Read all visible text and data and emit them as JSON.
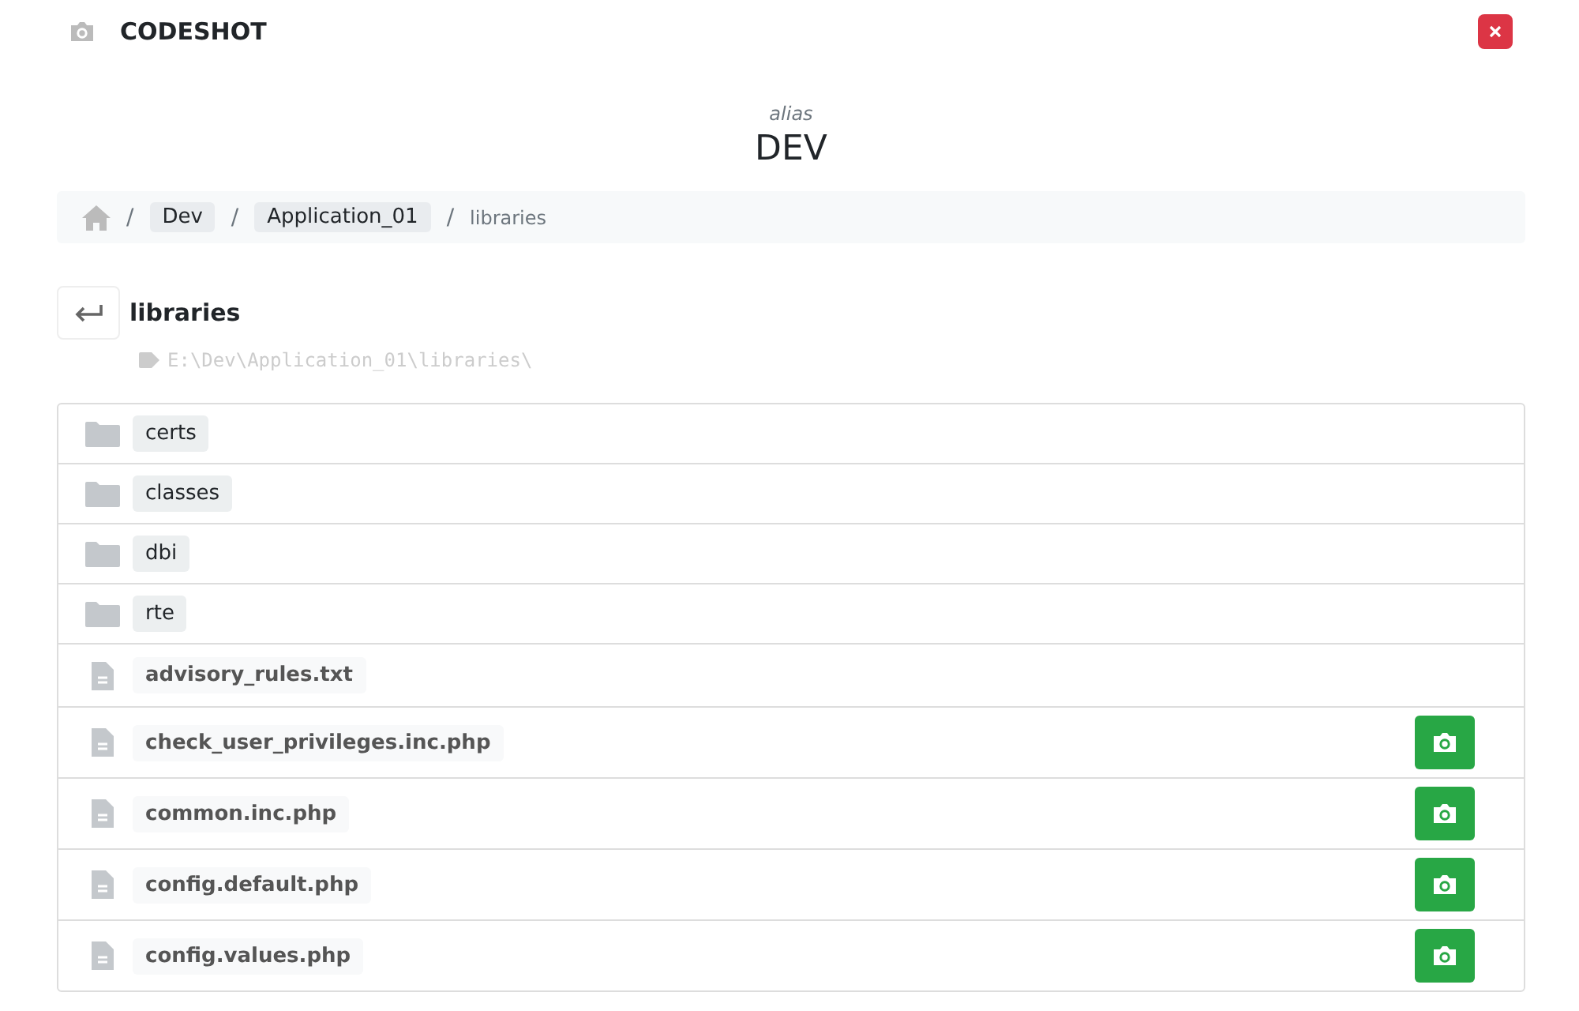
{
  "app": {
    "title": "CODESHOT"
  },
  "heading": {
    "caption": "alias",
    "title": "DEV"
  },
  "breadcrumb": {
    "separators": [
      "/",
      "/",
      "/"
    ],
    "links": [
      "Dev",
      "Application_01"
    ],
    "current": "libraries"
  },
  "folder": {
    "name": "libraries",
    "path": "E:\\Dev\\Application_01\\libraries\\"
  },
  "entries": [
    {
      "kind": "folder",
      "name": "certs",
      "snapshot": false
    },
    {
      "kind": "folder",
      "name": "classes",
      "snapshot": false
    },
    {
      "kind": "folder",
      "name": "dbi",
      "snapshot": false
    },
    {
      "kind": "folder",
      "name": "rte",
      "snapshot": false
    },
    {
      "kind": "file",
      "name": "advisory_rules.txt",
      "snapshot": false
    },
    {
      "kind": "file",
      "name": "check_user_privileges.inc.php",
      "snapshot": true
    },
    {
      "kind": "file",
      "name": "common.inc.php",
      "snapshot": true
    },
    {
      "kind": "file",
      "name": "config.default.php",
      "snapshot": true
    },
    {
      "kind": "file",
      "name": "config.values.php",
      "snapshot": true
    }
  ]
}
